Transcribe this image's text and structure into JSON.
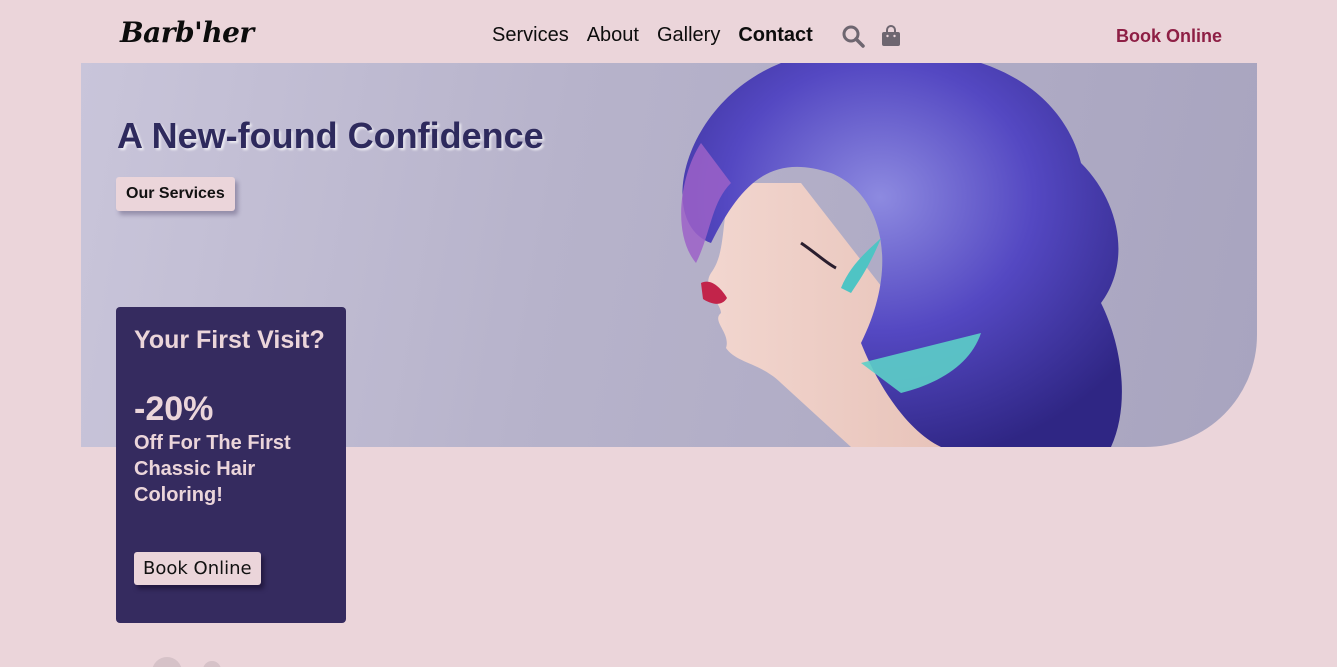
{
  "brand": {
    "logo": "Barb'her"
  },
  "nav": {
    "items": [
      {
        "label": "Services"
      },
      {
        "label": "About"
      },
      {
        "label": "Gallery"
      },
      {
        "label": "Contact"
      }
    ],
    "book_online": "Book Online",
    "icons": [
      "search-icon",
      "shopping-bag-icon"
    ]
  },
  "hero": {
    "title": "A New-found Confidence",
    "cta": "Our Services"
  },
  "promo": {
    "heading": "Your First Visit?",
    "discount": "-20%",
    "text": "Off For The First Chassic Hair Coloring!",
    "cta": "Book Online"
  },
  "colors": {
    "background": "#ebd5da",
    "accent": "#8e1f45",
    "card": "#352b5f",
    "title": "#2e2a5d"
  }
}
